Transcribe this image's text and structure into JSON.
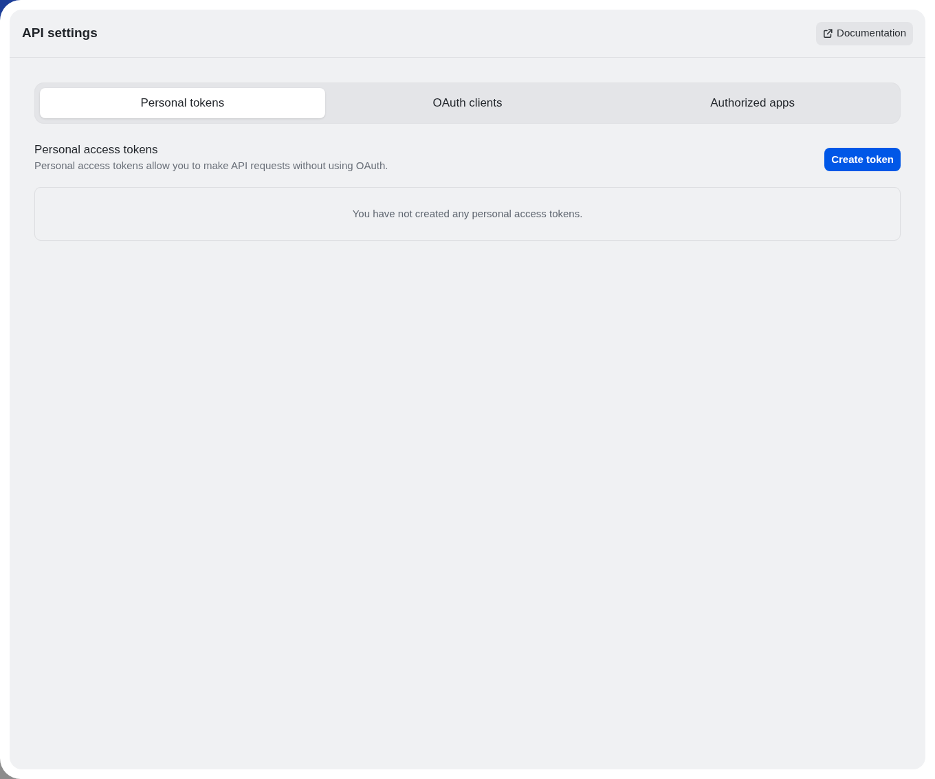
{
  "header": {
    "title": "API settings",
    "documentation_link": "Documentation"
  },
  "tabs": [
    {
      "label": "Personal tokens",
      "selected": true
    },
    {
      "label": "OAuth clients",
      "selected": false
    },
    {
      "label": "Authorized apps",
      "selected": false
    }
  ],
  "section": {
    "title": "Personal access tokens",
    "description": "Personal access tokens allow you to make API requests without using OAuth.",
    "create_button": "Create token",
    "empty_message": "You have not created any personal access tokens."
  }
}
